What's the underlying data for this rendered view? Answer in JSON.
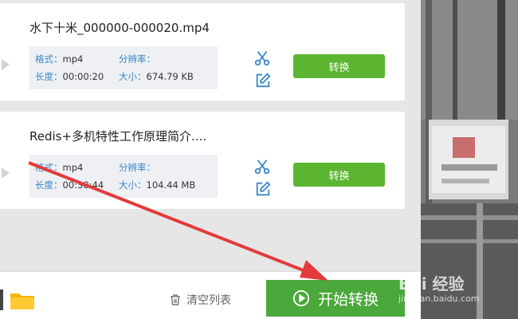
{
  "files": [
    {
      "name": "水下十米_000000-000020.mp4",
      "format_label": "格式：",
      "format": "mp4",
      "resolution_label": "分辨率：",
      "resolution": "",
      "duration_label": "长度：",
      "duration": "00:00:20",
      "size_label": "大小：",
      "size": "674.79 KB",
      "convert_label": "转换"
    },
    {
      "name": "Redis+多机特性工作原理简介....",
      "format_label": "格式：",
      "format": "mp4",
      "resolution_label": "分辨率：",
      "resolution": "",
      "duration_label": "长度：",
      "duration": "00:38:44",
      "size_label": "大小：",
      "size": "104.44 MB",
      "convert_label": "转换"
    }
  ],
  "bottombar": {
    "clear_list_label": "清空列表",
    "start_label": "开始转换"
  },
  "watermark": {
    "brand": "Bai 经验",
    "url": "jingyan.baidu.com"
  },
  "colors": {
    "green": "#5cb531",
    "start_green": "#4ba83a",
    "label_blue": "#3a87c8",
    "arrow_red": "#e33b3b"
  },
  "icons": [
    "scissors-icon",
    "edit-icon",
    "folder-icon",
    "trash-icon",
    "play-circle-icon"
  ]
}
